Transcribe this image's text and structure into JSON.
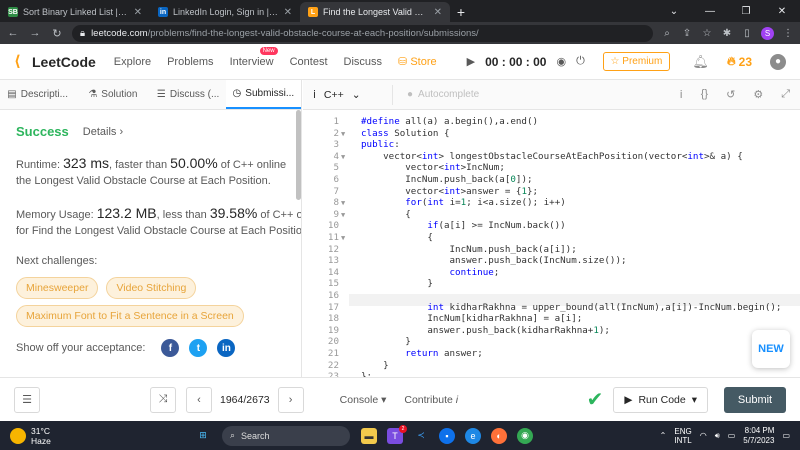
{
  "browser": {
    "tabs": [
      {
        "title": "Sort Binary Linked List | Interview",
        "favicon": "SB",
        "color": "#2f8d46"
      },
      {
        "title": "LinkedIn Login, Sign in | LinkedIn",
        "favicon": "in",
        "color": "#0a66c2"
      },
      {
        "title": "Find the Longest Valid Obstacle",
        "favicon": "L",
        "color": "#ffa116"
      }
    ],
    "url_domain": "leetcode.com",
    "url_path": "/problems/find-the-longest-valid-obstacle-course-at-each-position/submissions/",
    "profile_initial": "S"
  },
  "nav": {
    "logo": "LeetCode",
    "links": [
      "Explore",
      "Problems",
      "Interview",
      "Contest",
      "Discuss"
    ],
    "new_badge": "New",
    "store": "Store",
    "timer": "00 : 00 : 00",
    "premium": "Premium",
    "streak": "23"
  },
  "left": {
    "tabs": [
      "Descripti...",
      "Solution",
      "Discuss (...",
      "Submissi..."
    ],
    "success": "Success",
    "details": "Details",
    "runtime_prefix": "Runtime: ",
    "runtime_value": "323 ms",
    "runtime_mid": ", faster than ",
    "runtime_pct": "50.00%",
    "runtime_suffix": " of C++ online",
    "runtime_line2": "the Longest Valid Obstacle Course at Each Position.",
    "memory_prefix": "Memory Usage: ",
    "memory_value": "123.2 MB",
    "memory_mid": ", less than ",
    "memory_pct": "39.58%",
    "memory_suffix": " of C++ o",
    "memory_line2": "for Find the Longest Valid Obstacle Course at Each Positio",
    "next_label": "Next challenges:",
    "challenges": [
      "Minesweeper",
      "Video Stitching",
      "Maximum Font to Fit a Sentence in a Screen"
    ],
    "share_label": "Show off your acceptance:"
  },
  "editor": {
    "language": "C++",
    "autocomplete": "Autocomplete",
    "new_label": "NEW",
    "lines": [
      "#define all(a) a.begin(),a.end()",
      "class Solution {",
      "public:",
      "    vector<int> longestObstacleCourseAtEachPosition(vector<int>& a) {",
      "        vector<int>IncNum;",
      "        IncNum.push_back(a[0]);",
      "        vector<int>answer = {1};",
      "        for(int i=1; i<a.size(); i++)",
      "        {",
      "            if(a[i] >= IncNum.back())",
      "            {",
      "                IncNum.push_back(a[i]);",
      "                answer.push_back(IncNum.size());",
      "                continue;",
      "            }",
      "",
      "            int kidharRakhna = upper_bound(all(IncNum),a[i])-IncNum.begin();",
      "            IncNum[kidharRakhna] = a[i];",
      "            answer.push_back(kidharRakhna+1);",
      "        }",
      "        return answer;",
      "    }",
      "};"
    ],
    "fold_lines": [
      2,
      4,
      8,
      9,
      11
    ]
  },
  "bottom": {
    "pager": "1964/2673",
    "console": "Console",
    "contribute": "Contribute",
    "run_code": "Run Code",
    "submit": "Submit"
  },
  "taskbar": {
    "temp": "31°C",
    "weather": "Haze",
    "search": "Search",
    "lang_top": "ENG",
    "lang_bottom": "INTL",
    "time": "8:04 PM",
    "date": "5/7/2023",
    "notif_count": "2"
  }
}
